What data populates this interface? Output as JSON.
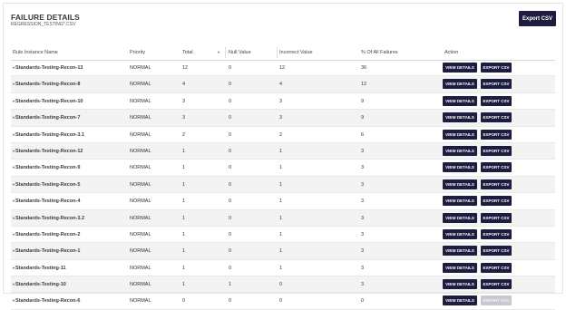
{
  "header": {
    "title": "FAILURE DETAILS",
    "subtitle": "REGRESSION_TESTING*.CSV",
    "export_label": "Export CSV"
  },
  "columns": {
    "rule": "Rule Instance Name",
    "priority": "Priority",
    "total": "Total",
    "null_value": "Null Value",
    "incorrect": "Incorrect Value",
    "percent": "% Of All Failures",
    "action": "Action"
  },
  "icons": {
    "sort": "sort-down-icon",
    "expand": "chevron-down-icon"
  },
  "button_labels": {
    "view": "VIEW DETAILS",
    "export": "EXPORT CSV"
  },
  "rows": [
    {
      "name": "Standards-Testing-Recon-13",
      "priority": "NORMAL",
      "total": "12",
      "null": "0",
      "incorrect": "12",
      "percent": "36",
      "export_enabled": true
    },
    {
      "name": "Standards-Testing-Recon-8",
      "priority": "NORMAL",
      "total": "4",
      "null": "0",
      "incorrect": "4",
      "percent": "12",
      "export_enabled": true
    },
    {
      "name": "Standards-Testing-Recon-10",
      "priority": "NORMAL",
      "total": "3",
      "null": "0",
      "incorrect": "3",
      "percent": "9",
      "export_enabled": true
    },
    {
      "name": "Standards-Testing-Recon-7",
      "priority": "NORMAL",
      "total": "3",
      "null": "0",
      "incorrect": "3",
      "percent": "9",
      "export_enabled": true
    },
    {
      "name": "Standards-Testing-Recon-3.1",
      "priority": "NORMAL",
      "total": "2",
      "null": "0",
      "incorrect": "2",
      "percent": "6",
      "export_enabled": true
    },
    {
      "name": "Standards-Testing-Recon-12",
      "priority": "NORMAL",
      "total": "1",
      "null": "0",
      "incorrect": "1",
      "percent": "3",
      "export_enabled": true
    },
    {
      "name": "Standards-Testing-Recon-9",
      "priority": "NORMAL",
      "total": "1",
      "null": "0",
      "incorrect": "1",
      "percent": "3",
      "export_enabled": true
    },
    {
      "name": "Standards-Testing-Recon-5",
      "priority": "NORMAL",
      "total": "1",
      "null": "0",
      "incorrect": "1",
      "percent": "3",
      "export_enabled": true
    },
    {
      "name": "Standards-Testing-Recon-4",
      "priority": "NORMAL",
      "total": "1",
      "null": "0",
      "incorrect": "1",
      "percent": "3",
      "export_enabled": true
    },
    {
      "name": "Standards-Testing-Recon-3.2",
      "priority": "NORMAL",
      "total": "1",
      "null": "0",
      "incorrect": "1",
      "percent": "3",
      "export_enabled": true
    },
    {
      "name": "Standards-Testing-Recon-2",
      "priority": "NORMAL",
      "total": "1",
      "null": "0",
      "incorrect": "1",
      "percent": "3",
      "export_enabled": true
    },
    {
      "name": "Standards-Testing-Recon-1",
      "priority": "NORMAL",
      "total": "1",
      "null": "0",
      "incorrect": "1",
      "percent": "3",
      "export_enabled": true
    },
    {
      "name": "Standards-Testing-11",
      "priority": "NORMAL",
      "total": "1",
      "null": "0",
      "incorrect": "1",
      "percent": "3",
      "export_enabled": true
    },
    {
      "name": "Standards-Testing-10",
      "priority": "NORMAL",
      "total": "1",
      "null": "1",
      "incorrect": "0",
      "percent": "3",
      "export_enabled": true
    },
    {
      "name": "Standards-Testing-Recon-6",
      "priority": "NORMAL",
      "total": "0",
      "null": "0",
      "incorrect": "0",
      "percent": "0",
      "export_enabled": false
    }
  ],
  "colors": {
    "primary_button": "#1c1d3f",
    "disabled_button": "#c7c8d2",
    "row_alt": "#f3f3f3"
  }
}
